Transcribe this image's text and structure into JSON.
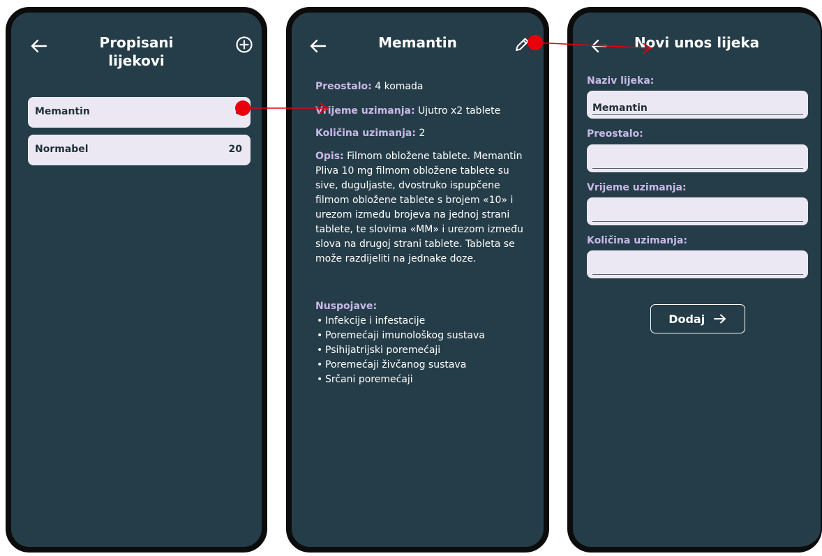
{
  "colors": {
    "screen_bg": "#253d48",
    "frame": "#0c0c0c",
    "card_bg": "#ece8f3",
    "label": "#c9b9e8",
    "flow_arrow": "#e8000d"
  },
  "list_screen": {
    "back_icon": "arrow-left-icon",
    "title_line1": "Propisani",
    "title_line2": "lijekovi",
    "add_icon": "plus-circle-icon",
    "items": [
      {
        "name": "Memantin",
        "count": "8"
      },
      {
        "name": "Normabel",
        "count": "20"
      }
    ]
  },
  "detail_screen": {
    "back_icon": "arrow-left-icon",
    "title": "Memantin",
    "edit_icon": "pencil-icon",
    "remaining_label": "Preostalo:",
    "remaining_value": " 4 komada",
    "time_label": "Vrijeme uzimanja:",
    "time_value": " Ujutro x2 tablete",
    "quantity_label": "Količina uzimanja:",
    "quantity_value": " 2",
    "desc_label": "Opis:",
    "desc_value": " Filmom obložene tablete. Memantin Pliva 10 mg filmom obložene tablete su sive, duguljaste, dvostruko ispupčene filmom obložene tablete s brojem «10» i urezom između brojeva na jednoj strani tablete, te slovima «MM» i urezom između slova na drugoj strani tablete. Tableta se može razdijeliti na jednake doze.",
    "side_effects_label": "Nuspojave:",
    "side_effects": [
      "Infekcije i infestacije",
      "Poremećaji imunološkog sustava",
      "Psihijatrijski poremećaji",
      "Poremećaji živčanog sustava",
      "Srčani poremećaji"
    ]
  },
  "form_screen": {
    "back_icon": "arrow-left-icon",
    "title": "Novi unos lijeka",
    "name_label": "Naziv lijeka:",
    "name_value": "Memantin",
    "remaining_label": "Preostalo:",
    "remaining_value": "",
    "time_label": "Vrijeme uzimanja:",
    "time_value": "",
    "quantity_label": "Količina uzimanja:",
    "quantity_value": "",
    "submit_label": "Dodaj",
    "submit_icon": "arrow-right-icon"
  }
}
